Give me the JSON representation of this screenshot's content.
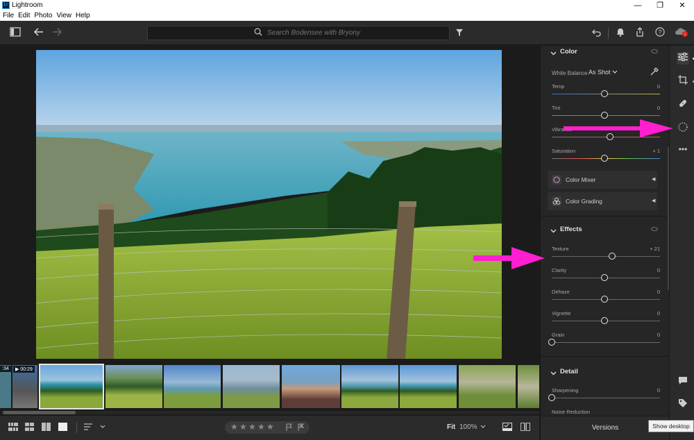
{
  "window": {
    "app_title": "Lightroom",
    "logo_text": "Lr",
    "minimize_glyph": "—",
    "maximize_glyph": "❐",
    "close_glyph": "✕"
  },
  "menu": [
    "File",
    "Edit",
    "Photo",
    "View",
    "Help"
  ],
  "toolbar": {
    "search_placeholder": "Search Bodensee with Bryony"
  },
  "filmstrip": {
    "badges": [
      ":34",
      "▶ 00:29"
    ]
  },
  "bottombar": {
    "zoom_label": "Fit",
    "zoom_percent": "100%",
    "stars": [
      "★",
      "★",
      "★",
      "★",
      "★"
    ],
    "rating": 0
  },
  "panel": {
    "color": {
      "title": "Color",
      "white_balance_label": "White Balance",
      "white_balance_value": "As Shot",
      "sliders": [
        {
          "label": "Temp",
          "value": "0",
          "pos": 0.5
        },
        {
          "label": "Tint",
          "value": "0",
          "pos": 0.5
        },
        {
          "label": "Vibrance",
          "value": "",
          "pos": 0.55
        },
        {
          "label": "Saturation",
          "value": "+ 1",
          "pos": 0.5
        }
      ],
      "mixer_label": "Color Mixer",
      "grading_label": "Color Grading"
    },
    "effects": {
      "title": "Effects",
      "sliders": [
        {
          "label": "Texture",
          "value": "+ 21",
          "pos": 0.57
        },
        {
          "label": "Clarity",
          "value": "0",
          "pos": 0.5
        },
        {
          "label": "Dehaze",
          "value": "0",
          "pos": 0.5
        },
        {
          "label": "Vignette",
          "value": "0",
          "pos": 0.5
        },
        {
          "label": "Grain",
          "value": "0",
          "pos": 0.0
        }
      ]
    },
    "detail": {
      "title": "Detail",
      "sliders": [
        {
          "label": "Sharpening",
          "value": "0",
          "pos": 0.0
        },
        {
          "label": "Noise Reduction",
          "value": "",
          "pos": 0.0
        }
      ]
    }
  },
  "versions_label": "Versions",
  "tooltip": "Show desktop",
  "colors": {
    "accent_arrow": "#ff1fd0",
    "sky": "#7fb2e0",
    "lake": "#3aa0b8",
    "grass": "#8fae3a"
  }
}
